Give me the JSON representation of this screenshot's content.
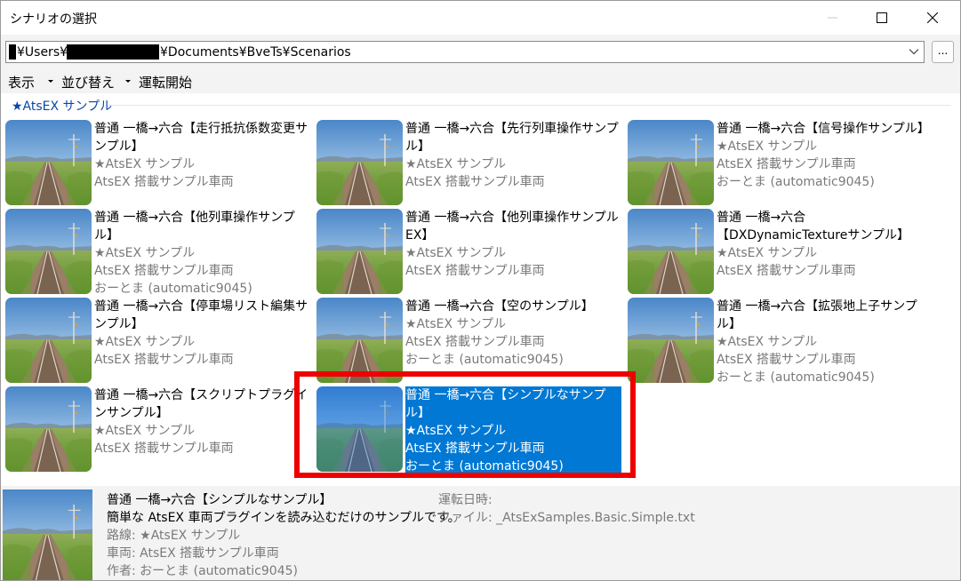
{
  "window": {
    "title": "シナリオの選択"
  },
  "path": {
    "prefix": "¥Users¥",
    "suffix": "¥Documents¥BveTs¥Scenarios",
    "browse_label": "..."
  },
  "menu": [
    {
      "label": "表示",
      "has_dropdown": true
    },
    {
      "label": "並び替え",
      "has_dropdown": true
    },
    {
      "label": "運転開始",
      "has_dropdown": false
    }
  ],
  "group": {
    "label": "★AtsEX サンプル"
  },
  "scenarios": [
    {
      "title": "普通 一橋→六合【走行抵抗係数変更サンプル】",
      "route": "★AtsEX サンプル",
      "vehicle": "AtsEX 搭載サンプル車両",
      "author": "",
      "selected": false
    },
    {
      "title": "普通 一橋→六合【先行列車操作サンプル】",
      "route": "★AtsEX サンプル",
      "vehicle": "AtsEX 搭載サンプル車両",
      "author": "",
      "selected": false
    },
    {
      "title": "普通 一橋→六合【信号操作サンプル】",
      "route": "★AtsEX サンプル",
      "vehicle": "AtsEX 搭載サンプル車両",
      "author": "おーとま (automatic9045)",
      "selected": false
    },
    {
      "title": "普通 一橋→六合【他列車操作サンプル】",
      "route": "★AtsEX サンプル",
      "vehicle": "AtsEX 搭載サンプル車両",
      "author": "おーとま (automatic9045)",
      "selected": false
    },
    {
      "title": "普通 一橋→六合【他列車操作サンプルEX】",
      "route": "★AtsEX サンプル",
      "vehicle": "AtsEX 搭載サンプル車両",
      "author": "",
      "selected": false
    },
    {
      "title": "普通 一橋→六合【DXDynamicTextureサンプル】",
      "route": "★AtsEX サンプル",
      "vehicle": "AtsEX 搭載サンプル車両",
      "author": "",
      "selected": false
    },
    {
      "title": "普通 一橋→六合【停車場リスト編集サンプル】",
      "route": "★AtsEX サンプル",
      "vehicle": "AtsEX 搭載サンプル車両",
      "author": "",
      "selected": false
    },
    {
      "title": "普通 一橋→六合【空のサンプル】",
      "route": "★AtsEX サンプル",
      "vehicle": "AtsEX 搭載サンプル車両",
      "author": "おーとま (automatic9045)",
      "selected": false
    },
    {
      "title": "普通 一橋→六合【拡張地上子サンプル】",
      "route": "★AtsEX サンプル",
      "vehicle": "AtsEX 搭載サンプル車両",
      "author": "おーとま (automatic9045)",
      "selected": false
    },
    {
      "title": "普通 一橋→六合【スクリプトプラグインサンプル】",
      "route": "★AtsEX サンプル",
      "vehicle": "AtsEX 搭載サンプル車両",
      "author": "",
      "selected": false
    },
    {
      "title": "普通 一橋→六合【シンプルなサンプル】",
      "route": "★AtsEX サンプル",
      "vehicle": "AtsEX 搭載サンプル車両",
      "author": "おーとま (automatic9045)",
      "selected": true
    }
  ],
  "details": {
    "title": "普通 一橋→六合【シンプルなサンプル】",
    "description": "簡単な AtsEX 車両プラグインを読み込むだけのサンプルです。",
    "route": "路線: ★AtsEX サンプル",
    "vehicle": "車両: AtsEX 搭載サンプル車両",
    "author": "作者: おーとま (automatic9045)",
    "last_run": "運転日時:",
    "file": "ファイル: _AtsExSamples.Basic.Simple.txt"
  },
  "colors": {
    "selection": "#0078d4",
    "group_header": "#0a46aa",
    "highlight": "#ee0000",
    "secondary_text": "#7a7a7a"
  }
}
